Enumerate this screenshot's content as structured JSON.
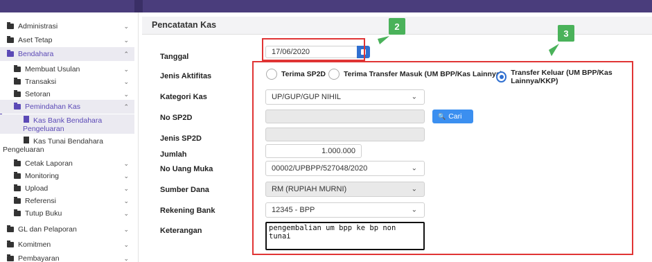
{
  "sidebar": {
    "items": [
      {
        "label": "Administrasi"
      },
      {
        "label": "Aset Tetap"
      },
      {
        "label": "Bendahara"
      },
      {
        "label": "Membuat Usulan"
      },
      {
        "label": "Transaksi"
      },
      {
        "label": "Setoran"
      },
      {
        "label": "Pemindahan Kas"
      },
      {
        "label_line1": "Kas Bank Bendahara",
        "label_line2": "Pengeluaran"
      },
      {
        "label_line1": "Kas Tunai Bendahara",
        "label_line2": "Pengeluaran"
      },
      {
        "label": "Cetak Laporan"
      },
      {
        "label": "Monitoring"
      },
      {
        "label": "Upload"
      },
      {
        "label": "Referensi"
      },
      {
        "label": "Tutup Buku"
      },
      {
        "label": "GL dan Pelaporan"
      },
      {
        "label": "Komitmen"
      },
      {
        "label": "Pembayaran"
      }
    ]
  },
  "panel": {
    "title": "Pencatatan Kas"
  },
  "form": {
    "tanggal": {
      "label": "Tanggal",
      "value": "17/06/2020"
    },
    "jenis_aktifitas": {
      "label": "Jenis Aktifitas",
      "options": [
        {
          "label": "Terima SP2D",
          "selected": false
        },
        {
          "label": "Terima Transfer Masuk (UM BPP/Kas Lainnya)",
          "selected": false
        },
        {
          "label": "Transfer Keluar (UM BPP/Kas Lainnya/KKP)",
          "selected": true
        }
      ]
    },
    "kategori_kas": {
      "label": "Kategori Kas",
      "value": "UP/GUP/GUP NIHIL"
    },
    "no_sp2d": {
      "label": "No SP2D",
      "value": "",
      "button": "Cari"
    },
    "jenis_sp2d": {
      "label": "Jenis SP2D",
      "value": ""
    },
    "jumlah": {
      "label": "Jumlah",
      "value": "1.000.000"
    },
    "no_uang_muka": {
      "label": "No Uang Muka",
      "value": "00002/UPBPP/527048/2020"
    },
    "sumber_dana": {
      "label": "Sumber Dana",
      "value": "RM (RUPIAH MURNI)"
    },
    "rekening_bank": {
      "label": "Rekening Bank",
      "value": "12345 - BPP"
    },
    "keterangan": {
      "label": "Keterangan",
      "value": "pengembalian um bpp ke bp non tunai"
    }
  },
  "annotations": {
    "callout_2": "2",
    "callout_3": "3",
    "highlight_color": "#e03434",
    "callout_color": "#4ab25a"
  },
  "colors": {
    "accent": "#5b49b6",
    "primary": "#2f6fd0",
    "topbar": "#4a3d7c"
  }
}
